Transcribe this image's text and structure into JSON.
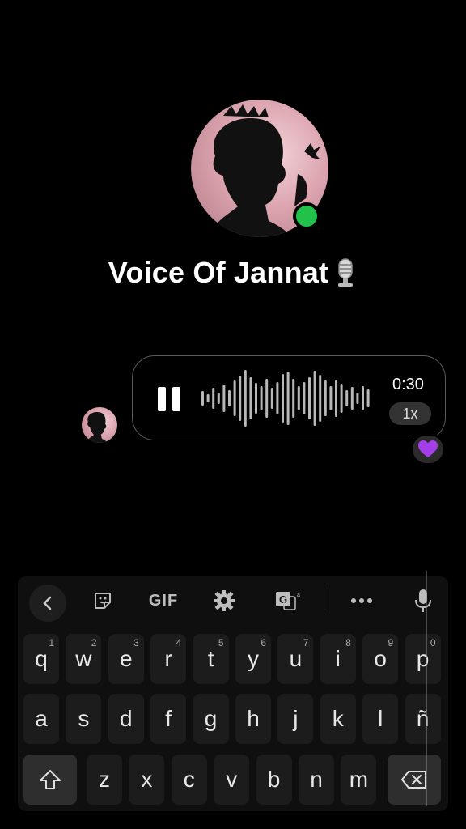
{
  "profile": {
    "name": "Voice Of Jannat",
    "status_color": "#22c24a"
  },
  "voice_message": {
    "duration": "0:30",
    "speed": "1x",
    "state_icon": "pause-icon",
    "reaction": "💜"
  },
  "keyboard": {
    "toolbar": {
      "back_icon": "chevron-left-icon",
      "sticker_icon": "sticker-icon",
      "gif_label": "GIF",
      "settings_icon": "gear-icon",
      "translate_icon": "translate-icon",
      "more_icon": "more-dots-icon",
      "mic_icon": "mic-icon"
    },
    "row1": [
      {
        "key": "q",
        "hint": "1"
      },
      {
        "key": "w",
        "hint": "2"
      },
      {
        "key": "e",
        "hint": "3"
      },
      {
        "key": "r",
        "hint": "4"
      },
      {
        "key": "t",
        "hint": "5"
      },
      {
        "key": "y",
        "hint": "6"
      },
      {
        "key": "u",
        "hint": "7"
      },
      {
        "key": "i",
        "hint": "8"
      },
      {
        "key": "o",
        "hint": "9"
      },
      {
        "key": "p",
        "hint": "0"
      }
    ],
    "row2": [
      "a",
      "s",
      "d",
      "f",
      "g",
      "h",
      "j",
      "k",
      "l",
      "ñ"
    ],
    "row3": [
      "z",
      "x",
      "c",
      "v",
      "b",
      "n",
      "m"
    ],
    "shift_icon": "shift-icon",
    "backspace_icon": "backspace-icon"
  }
}
